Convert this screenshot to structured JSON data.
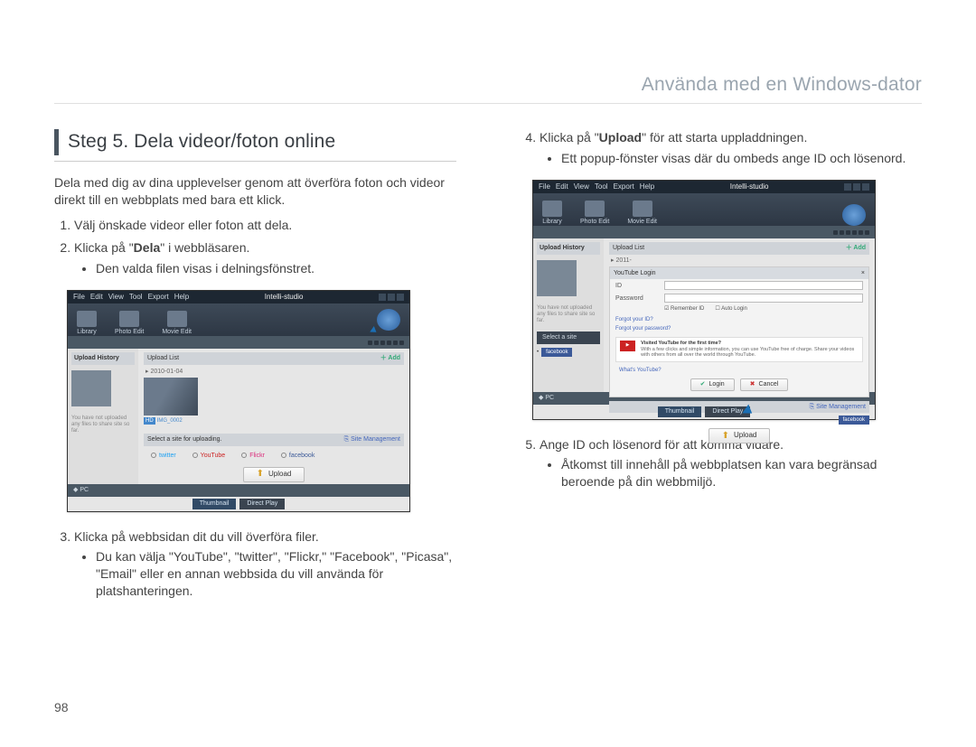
{
  "header": {
    "title": "Använda med en Windows-dator"
  },
  "page_number": "98",
  "left": {
    "step_title": "Steg 5. Dela videor/foton online",
    "intro": "Dela med dig av dina upplevelser genom att överföra foton och videor direkt till en webbplats med bara ett klick.",
    "items": {
      "i1": "Välj önskade videor eller foton att dela.",
      "i2_pre": "Klicka på \"",
      "i2_bold": "Dela",
      "i2_post": "\" i webbläsaren.",
      "i2_sub1": "Den valda filen visas i delningsfönstret.",
      "i3": "Klicka på webbsidan dit du vill överföra filer.",
      "i3_sub1": "Du kan välja \"YouTube\", \"twitter\", \"Flickr,\" \"Facebook\", \"Picasa\", \"Email\" eller en annan webbsida du vill använda för platshanteringen."
    }
  },
  "right": {
    "items": {
      "i4_pre": "Klicka på \"",
      "i4_bold": "Upload",
      "i4_post": "\" för att starta uppladdningen.",
      "i4_sub1": "Ett popup-fönster visas där du ombeds ange ID och lösenord.",
      "i5": "Ange ID och lösenord för att komma vidare.",
      "i5_sub1": "Åtkomst till innehåll på webbplatsen kan vara begränsad beroende på din webbmiljö."
    }
  },
  "mock": {
    "brand": "Intelli-studio",
    "menus": [
      "File",
      "Edit",
      "View",
      "Tool",
      "Export",
      "Help"
    ],
    "tabs": {
      "library": "Library",
      "photo": "Photo Edit",
      "movie": "Movie Edit"
    },
    "side": {
      "header": "Upload History",
      "empty_msg": "You have not uploaded any files to share site so far."
    },
    "center": {
      "header": "Upload List",
      "add": "Add",
      "date": "2010-01-04",
      "filename": "IMG_0002",
      "select_label": "Select a site for uploading.",
      "site_mgmt": "Site Management",
      "sites": {
        "twitter": "twitter",
        "youtube": "YouTube",
        "flickr": "Flickr",
        "facebook": "facebook"
      },
      "upload_btn": "Upload"
    },
    "footer": {
      "pc": "PC",
      "thumbnail": "Thumbnail",
      "direct": "Direct Play"
    },
    "login": {
      "title": "YouTube Login",
      "id_label": "ID",
      "pw_label": "Password",
      "remember": "Remember ID",
      "auto": "Auto Login",
      "forgot_id": "Forgot your ID?",
      "forgot_pw": "Forgot your password?",
      "prompt_head": "Visited YouTube for the first time?",
      "prompt_body": "With a few clicks and simple information, you can use YouTube free of charge. Share your videos with others from all over the world through YouTube.",
      "site_name": "What's YouTube?",
      "login_btn": "Login",
      "cancel_btn": "Cancel",
      "select_site": "Select a site",
      "facebook": "facebook"
    }
  }
}
